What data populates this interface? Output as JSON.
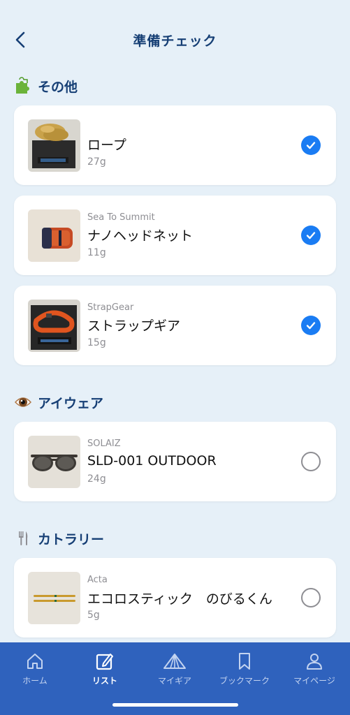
{
  "header": {
    "title": "準備チェック"
  },
  "sections": [
    {
      "title": "その他",
      "icon": "puzzle-icon",
      "items": [
        {
          "brand": "",
          "name": "ロープ",
          "weight": "27g",
          "checked": true,
          "image": "rope-photo"
        },
        {
          "brand": "Sea To Summit",
          "name": "ナノヘッドネット",
          "weight": "11g",
          "checked": true,
          "image": "headnet-photo"
        },
        {
          "brand": "StrapGear",
          "name": "ストラップギア",
          "weight": "15g",
          "checked": true,
          "image": "strap-photo"
        }
      ]
    },
    {
      "title": "アイウェア",
      "icon": "eye-icon",
      "items": [
        {
          "brand": "SOLAIZ",
          "name": "SLD-001 OUTDOOR",
          "weight": "24g",
          "checked": false,
          "image": "sunglasses-photo"
        }
      ]
    },
    {
      "title": "カトラリー",
      "icon": "fork-knife-icon",
      "items": [
        {
          "brand": "Acta",
          "name": "エコロスティック　のびるくん",
          "weight": "5g",
          "checked": false,
          "image": "chopsticks-photo"
        }
      ]
    }
  ],
  "tabbar": {
    "items": [
      {
        "label": "ホーム",
        "icon": "home-icon",
        "active": false
      },
      {
        "label": "リスト",
        "icon": "edit-icon",
        "active": true
      },
      {
        "label": "マイギア",
        "icon": "tent-icon",
        "active": false
      },
      {
        "label": "ブックマーク",
        "icon": "bookmark-icon",
        "active": false
      },
      {
        "label": "マイページ",
        "icon": "person-icon",
        "active": false
      }
    ]
  },
  "colors": {
    "accent": "#1a7cf3",
    "title": "#163f75",
    "background": "#e6f0f8",
    "tabbar": "#2f62bd"
  }
}
